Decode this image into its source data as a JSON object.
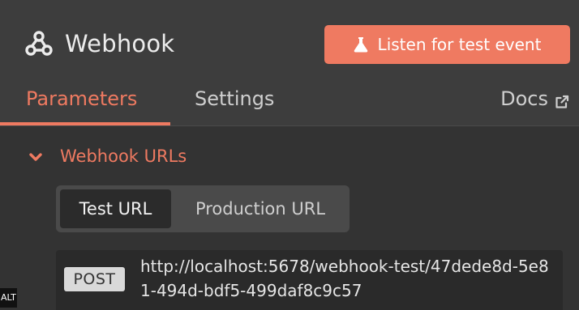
{
  "header": {
    "title": "Webhook",
    "listen_button_label": "Listen for test event"
  },
  "tabs": {
    "parameters": "Parameters",
    "settings": "Settings",
    "docs": "Docs"
  },
  "section": {
    "title": "Webhook URLs"
  },
  "url_switch": {
    "options": [
      "Test URL",
      "Production URL"
    ],
    "selected": "Test URL"
  },
  "url": {
    "method": "POST",
    "value": "http://localhost:5678/webhook-test/47dede8d-5e81-494d-bdf5-499daf8c9c57"
  },
  "corner_badge": "ALT",
  "colors": {
    "accent": "#ef7a61",
    "background": "#333333",
    "header_background": "#3d3d3d"
  },
  "icons": [
    "webhook-icon",
    "flask-icon",
    "external-link-icon",
    "chevron-down-icon"
  ]
}
